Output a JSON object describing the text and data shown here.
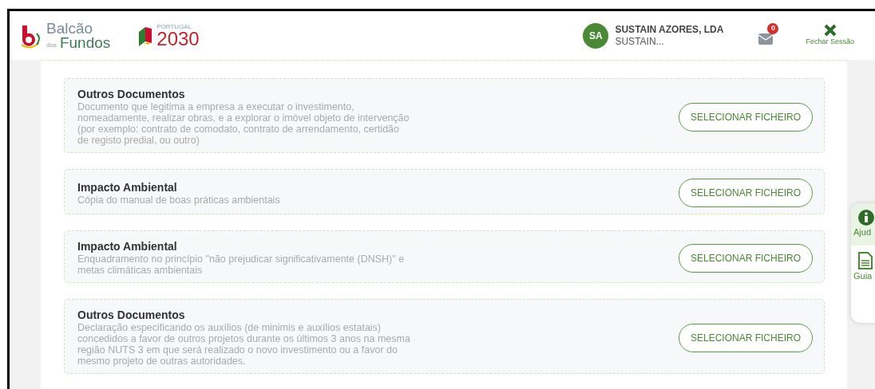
{
  "header": {
    "logo_balcao": {
      "line1": "Balcão",
      "small": "dos",
      "line2": "Fundos"
    },
    "logo_portugal": {
      "small": "PORTUGAL",
      "year": "2030"
    },
    "user": {
      "initials": "SA",
      "name": "SUSTAIN AZORES, LDA",
      "subtitle": "SUSTAIN..."
    },
    "messages": {
      "count": "0"
    },
    "logout": {
      "label": "Fechar Sessão"
    }
  },
  "documents": [
    {
      "title": "Outros Documentos",
      "description_lines": [
        "Documento que legitima a empresa a executar o investimento,",
        "nomeadamente, realizar obras, e a explorar o imóvel objeto de intervenção",
        "(por exemplo: contrato de comodato, contrato de arrendamento, certidão",
        "de registo predial, ou outro)"
      ],
      "button": "SELECIONAR FICHEIRO"
    },
    {
      "title": "Impacto Ambiental",
      "description_lines": [
        "Cópia do manual de boas práticas ambientais"
      ],
      "button": "SELECIONAR FICHEIRO"
    },
    {
      "title": "Impacto Ambiental",
      "description_lines": [
        "Enquadramento no princípio \"não prejudicar significativamente (DNSH)\" e",
        "metas climáticas ambientais"
      ],
      "button": "SELECIONAR FICHEIRO"
    },
    {
      "title": "Outros Documentos",
      "description_lines": [
        "Declaração especificando os auxílios (de minimis e auxílios estatais)",
        "concedidos a favor de outros projetos durante os últimos 3 anos na mesma",
        "região NUTS 3 em que será realizado o novo investimento ou a favor do",
        "mesmo projeto de outras autoridades."
      ],
      "button": "SELECIONAR FICHEIRO"
    }
  ],
  "side_panel": [
    {
      "kind": "help",
      "label": "Ajud",
      "selected": true
    },
    {
      "kind": "guide",
      "label": "Guia",
      "selected": false
    }
  ]
}
